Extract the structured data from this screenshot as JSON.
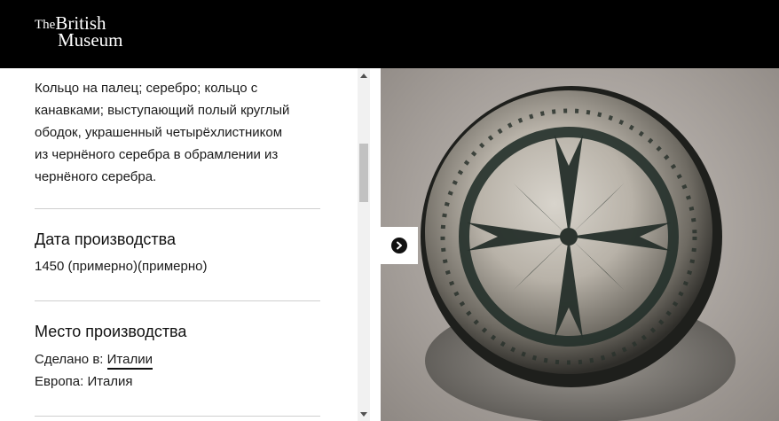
{
  "header": {
    "logo_the": "The",
    "logo_british": "British",
    "logo_museum": "Museum"
  },
  "object": {
    "description_lines": [
      "Кольцо на палец; серебро; кольцо с",
      "канавками; выступающий полый круглый",
      "ободок, украшенный четырёхлистником",
      "из чернёного серебра в обрамлении из",
      "чернёного серебра."
    ],
    "production_date": {
      "title": "Дата производства",
      "value": "1450 (примерно)(примерно)"
    },
    "production_place": {
      "title": "Место производства",
      "made_in_label": "Сделано в:",
      "made_in_link": "Италии",
      "region": "Европа: Италия"
    }
  },
  "viewer": {
    "next_icon": "chevron-right-icon",
    "image_subject": "silver ring with niello quatrefoil"
  },
  "colors": {
    "header_bg": "#000000",
    "accent_text": "#111111",
    "divider": "#cfcfcf"
  }
}
